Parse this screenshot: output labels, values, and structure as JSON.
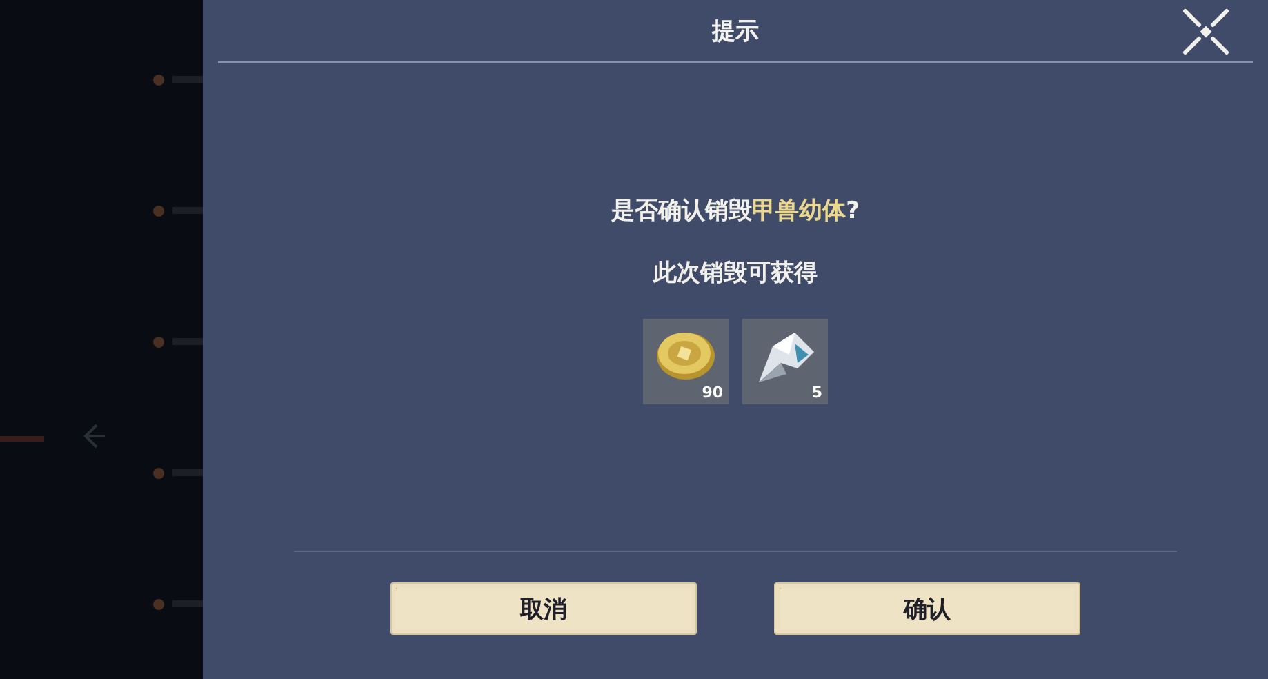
{
  "dialog": {
    "title": "提示",
    "message": [
      {
        "text": "是否确认销毁",
        "highlight": false
      },
      {
        "text": "甲兽幼体",
        "highlight": true
      },
      {
        "text": "?",
        "highlight": false
      }
    ],
    "subtitle": "此次销毁可获得",
    "rewards": [
      {
        "kind": "coin",
        "count": "90"
      },
      {
        "kind": "crystal",
        "count": "5"
      }
    ],
    "buttons": [
      "取消",
      "确认"
    ]
  }
}
